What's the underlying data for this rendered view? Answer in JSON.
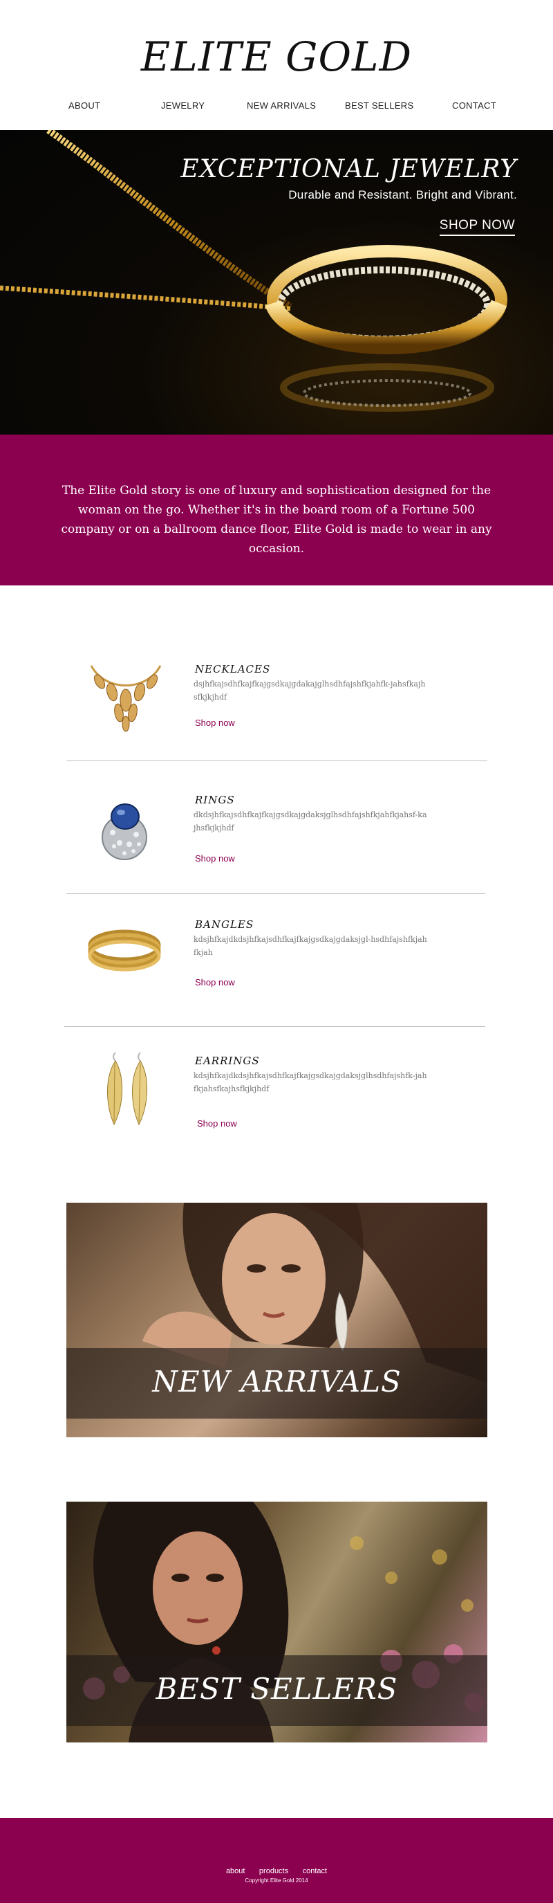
{
  "header": {
    "logo": "ELITE GOLD",
    "nav": [
      "ABOUT",
      "JEWELRY",
      "NEW ARRIVALS",
      "BEST SELLERS",
      "CONTACT"
    ]
  },
  "hero": {
    "title": "EXCEPTIONAL JEWELRY",
    "subtitle": "Durable and Resistant.  Bright and Vibrant.",
    "cta": "SHOP NOW",
    "image": "gold-ring-on-chain-photo"
  },
  "story": {
    "text": "The Elite Gold story is one of luxury and sophistication designed for the woman on the go. Whether it's in the board room of a Fortune 500 company or on a ballroom dance floor, Elite Gold is made to wear in any occasion."
  },
  "products": [
    {
      "name": "NECKLACES",
      "description": "dsjhfkajsdhfkajfkajgsdkajgdakajglhsdhfajshfkjahfk-jahsfkajhsfkjkjhdf",
      "link": "Shop now",
      "image": "gold-leaf-necklace-photo"
    },
    {
      "name": "RINGS",
      "description": "dkdsjhfkajsdhfkajfkajgsdkajgdaksjglhsdhfajshfkjahfkjahsf-kajhsfkjkjhdf",
      "link": "Shop now",
      "image": "sapphire-diamond-ring-photo"
    },
    {
      "name": "BANGLES",
      "description": "kdsjhfkajdkdsjhfkajsdhfkajfkajgsdkajgdaksjgl-hsdhfajshfkjahfkjah",
      "link": "Shop now",
      "image": "gold-bangles-photo"
    },
    {
      "name": "EARRINGS",
      "description": "kdsjhfkajdkdsjhfkajsdhfkajfkajgsdkajgdaksjglhsdhfajshfk-jahfkjahsfkajhsfkjkjhdf",
      "link": "Shop now",
      "image": "gold-leaf-earrings-photo"
    }
  ],
  "banners": {
    "new_arrivals": {
      "title": "NEW ARRIVALS",
      "image": "model-with-earring-photo"
    },
    "best_sellers": {
      "title": "BEST SELLERS",
      "image": "model-in-garden-photo"
    }
  },
  "footer": {
    "links": [
      "about",
      "products",
      "contact"
    ],
    "copyright": "Copyright Elite Gold 2014"
  },
  "colors": {
    "brand": "#8c0050",
    "text": "#222222",
    "muted": "#777777",
    "divider": "#bdbdbd"
  }
}
